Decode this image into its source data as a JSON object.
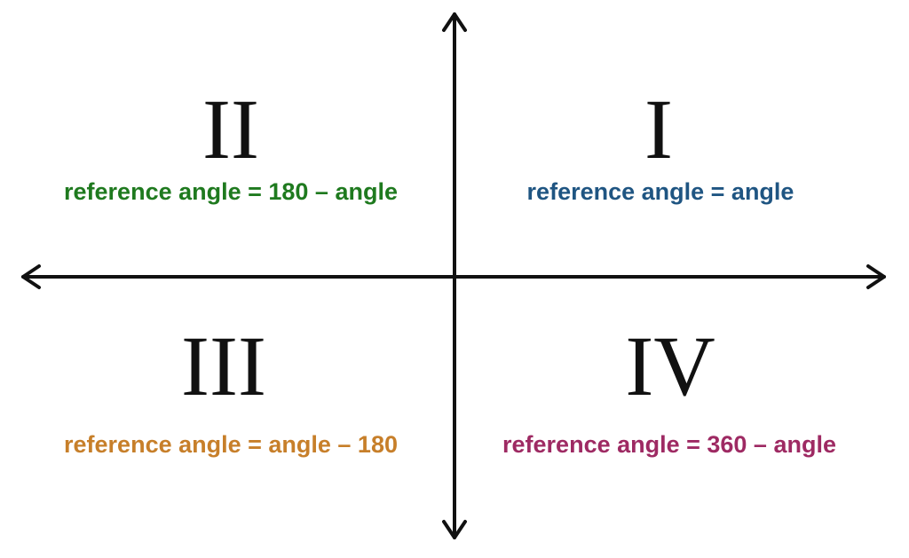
{
  "quadrants": {
    "q1": {
      "numeral": "I",
      "formula": "reference angle = angle",
      "color": "#1f5582"
    },
    "q2": {
      "numeral": "II",
      "formula": "reference angle = 180 – angle",
      "color": "#1f7a1f"
    },
    "q3": {
      "numeral": "III",
      "formula": "reference angle = angle – 180",
      "color": "#c77f2a"
    },
    "q4": {
      "numeral": "IV",
      "formula": "reference angle = 360 – angle",
      "color": "#9e2a63"
    }
  },
  "axis_color": "#111111"
}
